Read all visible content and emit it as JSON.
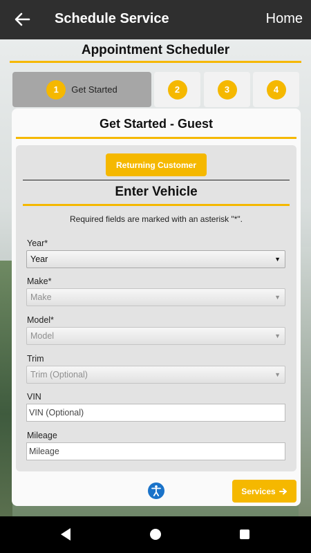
{
  "topbar": {
    "title": "Schedule Service",
    "home_label": "Home"
  },
  "app_title": "Appointment Scheduler",
  "steps": [
    {
      "number": "1",
      "label": "Get Started",
      "active": true
    },
    {
      "number": "2",
      "label": "",
      "active": false
    },
    {
      "number": "3",
      "label": "",
      "active": false
    },
    {
      "number": "4",
      "label": "",
      "active": false
    }
  ],
  "card": {
    "title": "Get Started - Guest",
    "returning_button": "Returning Customer",
    "vehicle_title": "Enter Vehicle",
    "required_note": "Required fields are marked with an asterisk \"*\".",
    "fields": {
      "year": {
        "label": "Year*",
        "value": "Year"
      },
      "make": {
        "label": "Make*",
        "value": "Make"
      },
      "model": {
        "label": "Model*",
        "value": "Model"
      },
      "trim": {
        "label": "Trim",
        "value": "Trim (Optional)"
      },
      "vin": {
        "label": "VIN",
        "placeholder": "VIN (Optional)"
      },
      "mileage": {
        "label": "Mileage",
        "placeholder": "Mileage"
      }
    },
    "services_button": "Services"
  },
  "colors": {
    "accent": "#f5b800",
    "topbar": "#2f2f2f"
  },
  "icons": {
    "back": "arrow-left-icon",
    "accessibility": "accessibility-icon",
    "next": "arrow-right-icon"
  }
}
